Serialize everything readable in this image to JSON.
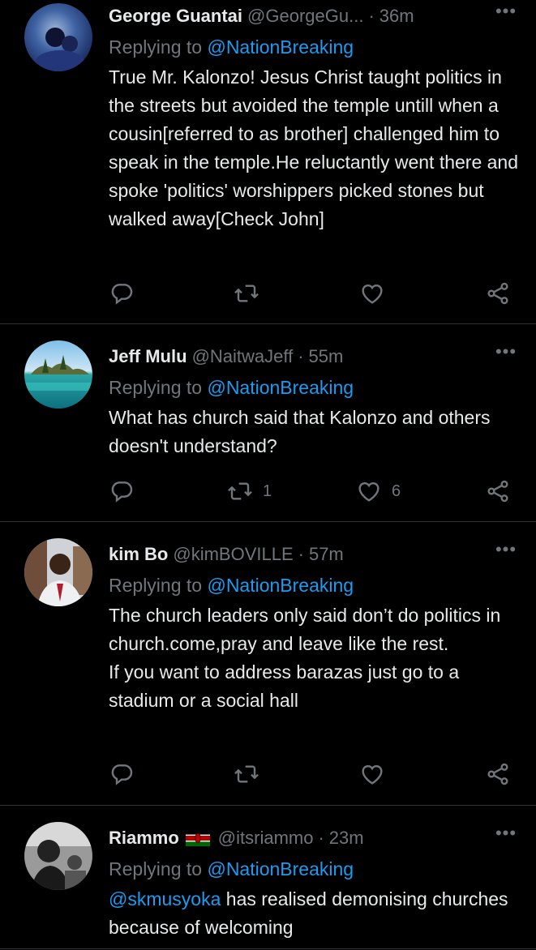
{
  "tweets": [
    {
      "name": "George Guantai",
      "handle": "@GeorgeGu...",
      "time": "36m",
      "reply_prefix": "Replying to",
      "reply_to": "@NationBreaking",
      "text": "True Mr. Kalonzo! Jesus Christ taught politics in the streets but avoided the temple untill when a cousin[referred to as brother] challenged him to speak in the temple.He reluctantly went there and spoke 'politics' worshippers picked stones but walked away[Check John]",
      "retweets": "",
      "likes": ""
    },
    {
      "name": "Jeff Mulu",
      "handle": "@NaitwaJeff",
      "time": "55m",
      "reply_prefix": "Replying to",
      "reply_to": "@NationBreaking",
      "text": "What has church said that Kalonzo and others doesn't understand?",
      "retweets": "1",
      "likes": "6"
    },
    {
      "name": "kim Bo",
      "handle": "@kimBOVILLE",
      "time": "57m",
      "reply_prefix": "Replying to",
      "reply_to": "@NationBreaking",
      "text_lines": [
        "The church leaders only said don’t do politics in church.come,pray and leave like the rest.",
        "If you want to address barazas just go to a stadium or a social hall"
      ],
      "retweets": "",
      "likes": ""
    },
    {
      "name": "Riammo",
      "flag_icon": "kenya-flag-icon",
      "handle": "@itsriammo",
      "time": "23m",
      "reply_prefix": "Replying to",
      "reply_to": "@NationBreaking",
      "text_mention": "@skmusyoka",
      "text": " has realised demonising churches because of welcoming"
    }
  ],
  "icons": {
    "reply": "reply-icon",
    "retweet": "retweet-icon",
    "like": "heart-icon",
    "share": "share-icon",
    "more": "more-icon"
  },
  "colors": {
    "background": "#000000",
    "text": "#e7e9ea",
    "muted": "#71767b",
    "link": "#1d9bf0"
  }
}
